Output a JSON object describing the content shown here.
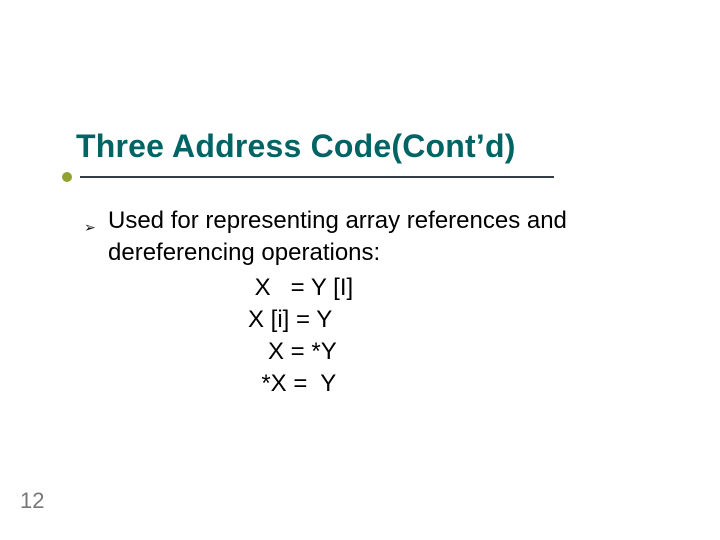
{
  "slide": {
    "title": "Three Address Code(Cont’d)",
    "intro": "Used for representing array references and dereferencing operations:",
    "equations": {
      "e1": " X   = Y [I]",
      "e2": "X [i] = Y",
      "e3": "   X = *Y",
      "e4": "  *X =  Y"
    },
    "page_number": "12"
  }
}
